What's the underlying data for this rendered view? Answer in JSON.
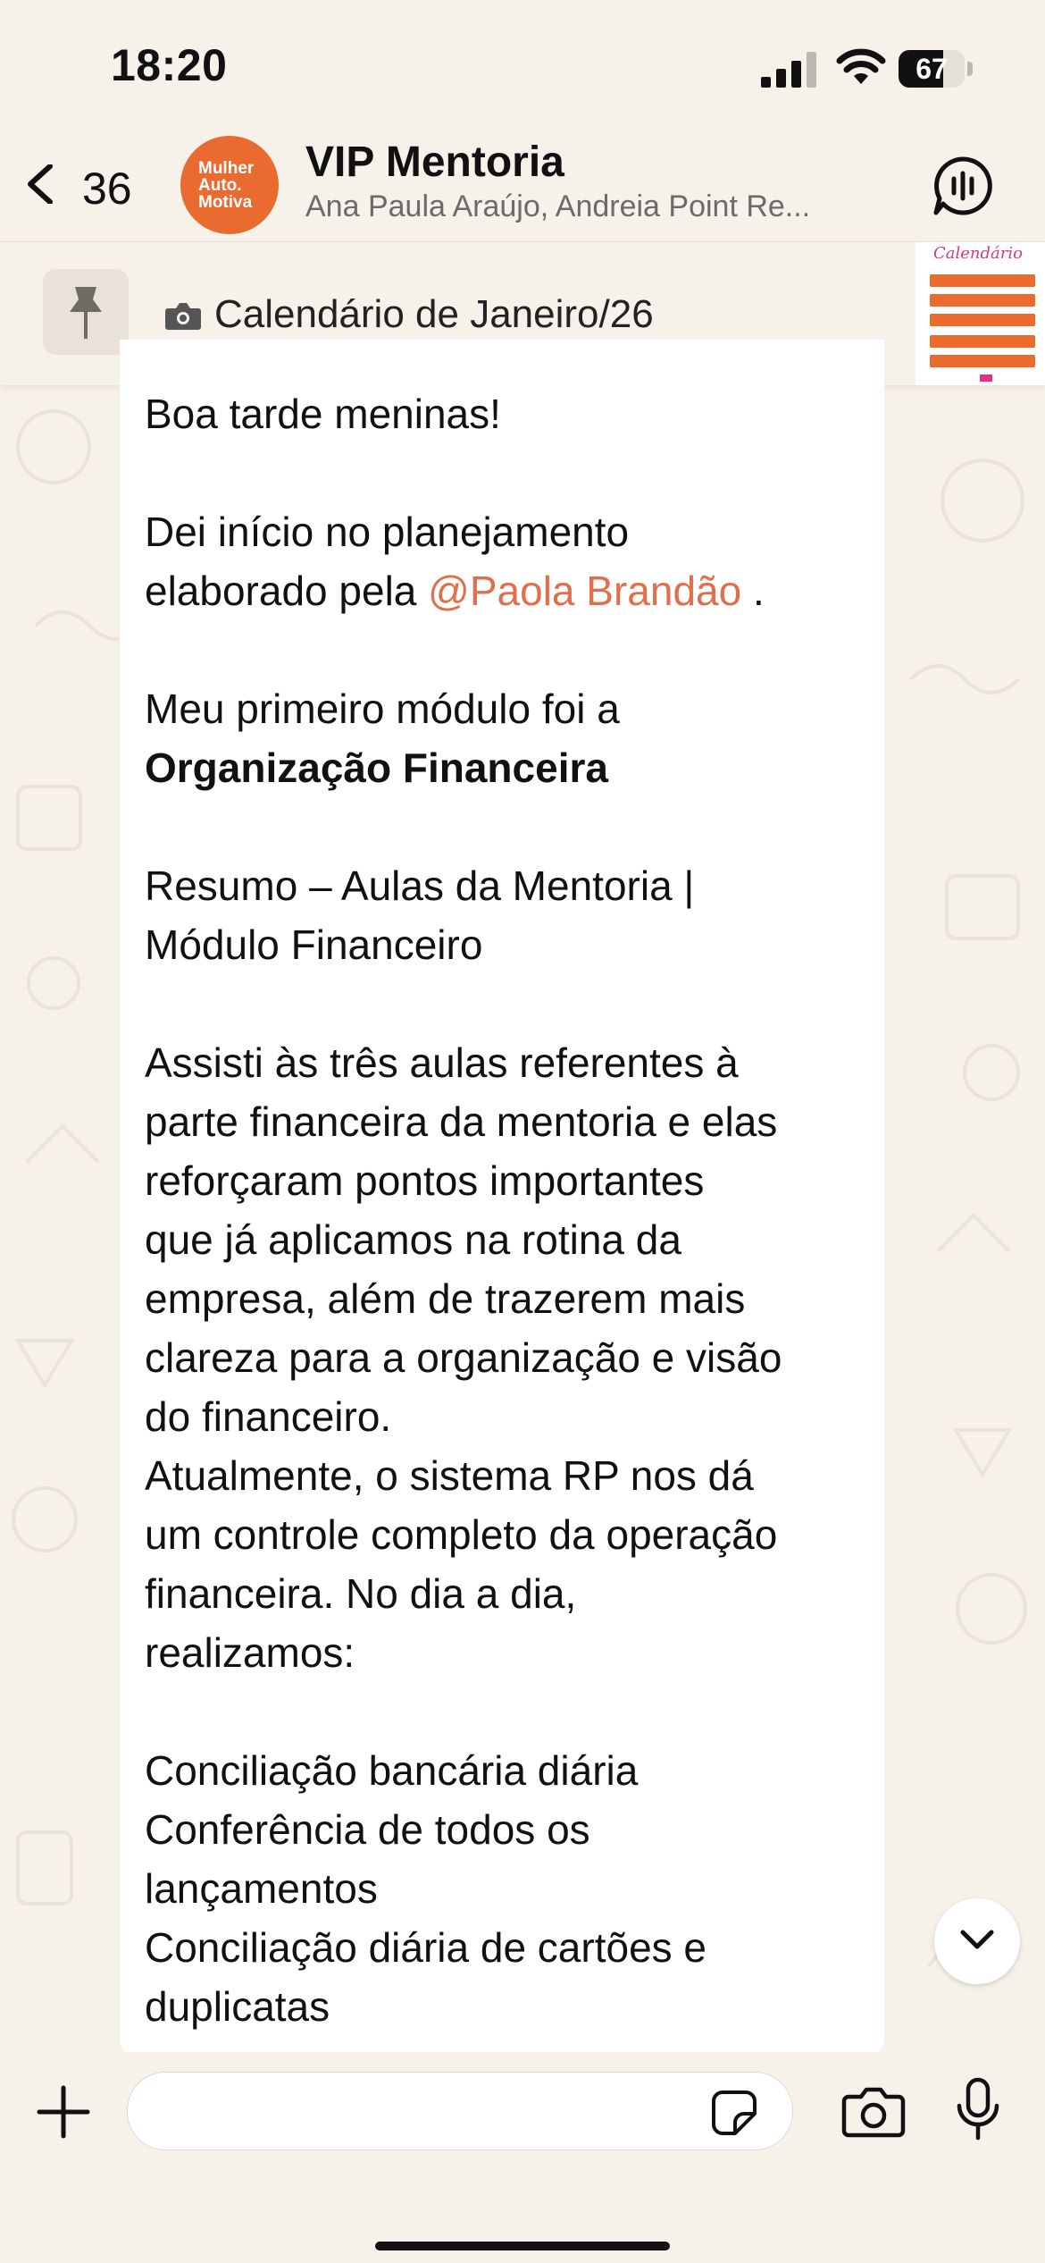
{
  "status_bar": {
    "time": "18:20",
    "battery": "67",
    "battery_level": 0.67,
    "icons": [
      "signal-icon",
      "wifi-icon",
      "battery-icon"
    ]
  },
  "header": {
    "back_count": "36",
    "avatar_lines": [
      "Mulher",
      "Auto.",
      "Motiva"
    ],
    "avatar_color": "#ea6b2f",
    "group_name": "VIP Mentoria",
    "members": "Ana Paula Araújo, Andreia Point Re...",
    "icons": [
      "chevron-left-icon",
      "voice-chat-icon"
    ]
  },
  "pinned": {
    "text": "Calendário de Janeiro/26",
    "thumbnail_title": "Calendário",
    "icons": [
      "pin-icon",
      "camera-icon"
    ]
  },
  "message": {
    "greeting": "Boa tarde meninas!",
    "line2a": "Dei início no planejamento",
    "line2b_prefix": "elaborado pela ",
    "mention": "@Paola Brandão",
    "line2b_suffix": " .",
    "line3a": "Meu primeiro módulo foi a",
    "line3b": "Organização Financeira",
    "line4a": "Resumo – Aulas da Mentoria |",
    "line4b": "Módulo Financeiro",
    "para5": [
      "Assisti às três aulas referentes à",
      "parte financeira da mentoria e elas",
      "reforçaram pontos importantes",
      "que já aplicamos na rotina da",
      "empresa, além de trazerem mais",
      "clareza para a organização e visão",
      "do financeiro.",
      "Atualmente, o sistema RP nos dá",
      "um controle completo da operação",
      "financeira. No dia a dia,",
      "realizamos:"
    ],
    "list": [
      "Conciliação bancária diária",
      "Conferência de todos os",
      "lançamentos",
      "Conciliação diária de cartões e",
      "duplicatas"
    ],
    "mention_color": "#e0704c"
  },
  "input_bar": {
    "placeholder": "",
    "icons": [
      "plus-icon",
      "sticker-icon",
      "camera-icon",
      "microphone-icon"
    ]
  }
}
